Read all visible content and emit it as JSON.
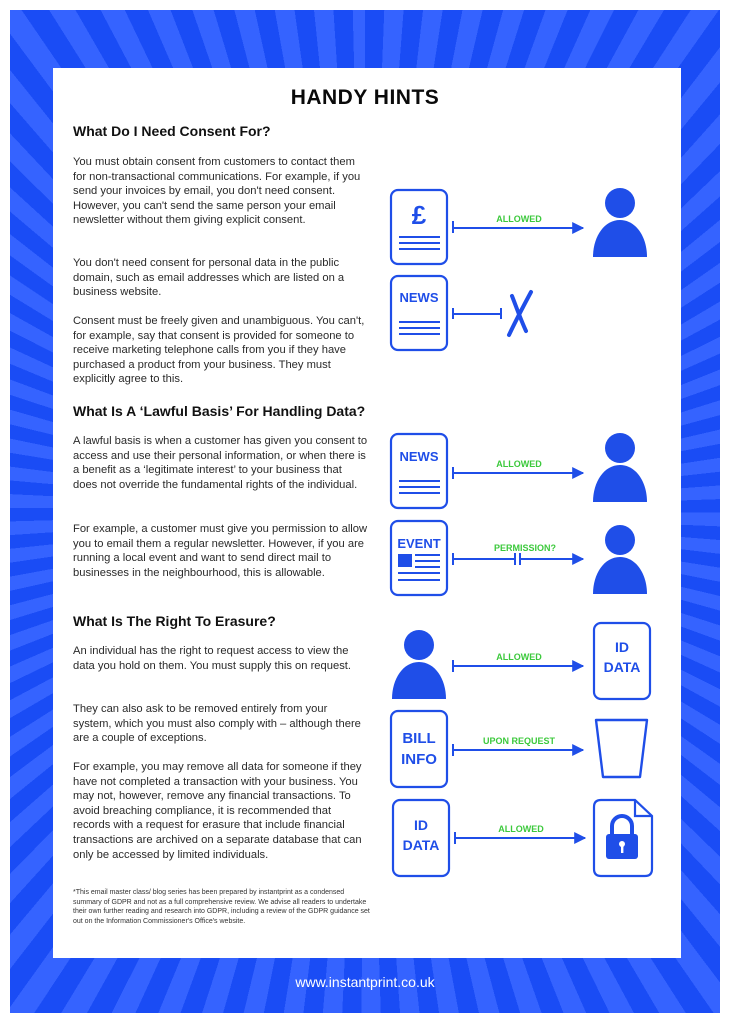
{
  "page": {
    "title": "HANDY HINTS",
    "footer_url": "www.instantprint.co.uk",
    "colors": {
      "brand_blue": "#1a4cf5",
      "icon_blue": "#1f4ee8",
      "label_green": "#3cc93c",
      "text": "#2a2a2a"
    }
  },
  "sections": [
    {
      "heading": "What Do I Need Consent For?",
      "paragraphs": [
        "You must obtain consent from customers to contact them for non-transactional communications. For example, if you send your invoices by email, you don't need consent. However, you can't send the same person your email newsletter without them giving explicit consent.",
        "You don't need consent for personal data in the public domain, such as email addresses which are listed on a business website.",
        "Consent must be freely given and unambiguous. You can't, for example, say that consent is provided for someone to receive marketing telephone calls from you if they have purchased a product from your business. They must explicitly agree to this."
      ]
    },
    {
      "heading": "What Is A ‘Lawful Basis’ For Handling Data?",
      "paragraphs": [
        "A lawful basis is when a customer has given you consent to access and use their personal information, or when there is a benefit as a ‘legitimate interest’ to your business that does not override the fundamental rights of the individual.",
        "For example, a customer must give you permission to allow you to email them a regular newsletter. However, if you are running a local event and want to send direct mail to businesses in the neighbourhood, this is allowable."
      ]
    },
    {
      "heading": "What Is The Right To Erasure?",
      "paragraphs": [
        "An individual has the right to request access to view the data you hold on them. You must supply this on request.",
        "They can also ask to be removed entirely from your system, which you must also comply with – although there are a couple of exceptions.",
        "For example, you may remove all data for someone if they have not completed a transaction with your business. You may not, however, remove any financial transactions. To avoid breaching compliance, it is recommended that records with a request for erasure that include financial transactions are archived on a separate database that can only be accessed by limited individuals."
      ]
    }
  ],
  "footnote": "*This email master class/ blog series has been prepared by instantprint as a condensed summary of GDPR and not as a full comprehensive review. We advise all readers to undertake their own further reading and research into GDPR, including a review of the GDPR guidance set out on the Information Commissioner's Office's website.",
  "diagrams": [
    {
      "from": "invoice-document (£)",
      "label": "ALLOWED",
      "to": "person"
    },
    {
      "from": "newsletter-document",
      "from_text": "NEWS",
      "label": "",
      "to": "cross (not allowed)"
    },
    {
      "from": "newsletter-document",
      "from_text": "NEWS",
      "label": "ALLOWED",
      "to": "person"
    },
    {
      "from": "event-document",
      "from_text": "EVENT",
      "label": "PERMISSION?",
      "to": "person"
    },
    {
      "from": "person",
      "label": "ALLOWED",
      "to": "id-data-document",
      "to_text": [
        "ID",
        "DATA"
      ]
    },
    {
      "from": "bill-info-document",
      "from_text": [
        "BILL",
        "INFO"
      ],
      "label": "UPON REQUEST",
      "to": "trash-bin"
    },
    {
      "from": "id-data-document",
      "from_text": [
        "ID",
        "DATA"
      ],
      "label": "ALLOWED",
      "to": "locked-file"
    }
  ],
  "icon_text": {
    "pound": "£",
    "news": "NEWS",
    "event": "EVENT",
    "id": "ID",
    "data": "DATA",
    "bill": "BILL",
    "info": "INFO",
    "allowed": "ALLOWED",
    "permission": "PERMISSION?",
    "upon_request": "UPON REQUEST"
  }
}
